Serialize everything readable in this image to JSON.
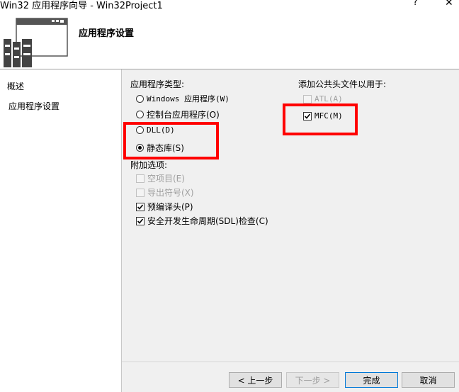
{
  "window": {
    "title": "Win32 应用程序向导 - Win32Project1",
    "help_glyph": "?",
    "close_glyph": "✕"
  },
  "header": {
    "page_title": "应用程序设置"
  },
  "nav": {
    "items": [
      {
        "label": "概述"
      },
      {
        "label": "应用程序设置"
      }
    ]
  },
  "app_type": {
    "label": "应用程序类型:",
    "options": [
      {
        "label": "Windows 应用程序(W)",
        "checked": false
      },
      {
        "label": "控制台应用程序(O)",
        "checked": false
      },
      {
        "label": "DLL(D)",
        "checked": false
      },
      {
        "label": "静态库(S)",
        "checked": true
      }
    ]
  },
  "extra_options": {
    "label": "附加选项:",
    "items": [
      {
        "label": "空项目(E)",
        "checked": false,
        "enabled": false
      },
      {
        "label": "导出符号(X)",
        "checked": false,
        "enabled": false
      },
      {
        "label": "预编译头(P)",
        "checked": true,
        "enabled": true
      },
      {
        "label": "安全开发生命周期(SDL)检查(C)",
        "checked": true,
        "enabled": true
      }
    ]
  },
  "common_headers": {
    "label": "添加公共头文件以用于:",
    "items": [
      {
        "label": "ATL(A)",
        "checked": false,
        "enabled": false
      },
      {
        "label": "MFC(M)",
        "checked": true,
        "enabled": true
      }
    ]
  },
  "buttons": {
    "prev": "< 上一步",
    "next": "下一步 >",
    "finish": "完成",
    "cancel": "取消"
  },
  "colors": {
    "highlight": "#ff0000",
    "panel_bg": "#f0f0f0",
    "default_button_border": "#0078d7"
  }
}
